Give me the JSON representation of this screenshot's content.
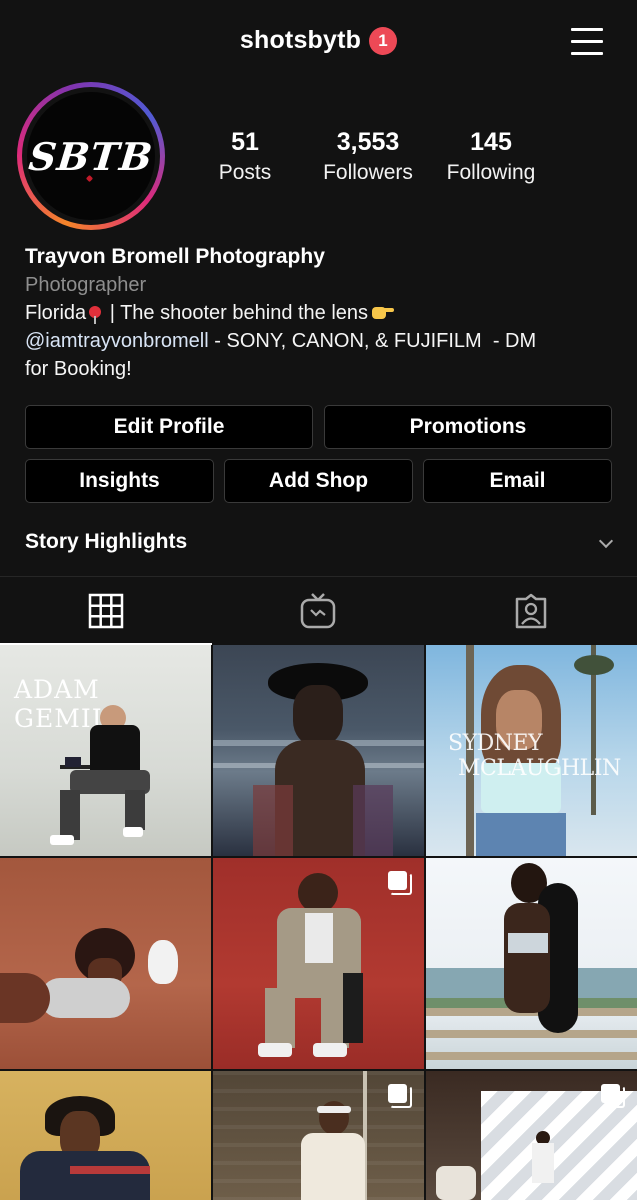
{
  "header": {
    "username": "shotsbytb",
    "notification_count": "1",
    "menu_icon": "hamburger-menu-icon"
  },
  "profile": {
    "avatar_text": "SBTB",
    "stats": [
      {
        "value": "51",
        "label": "Posts"
      },
      {
        "value": "3,553",
        "label": "Followers"
      },
      {
        "value": "145",
        "label": "Following"
      }
    ],
    "name": "Trayvon Bromell Photography",
    "category": "Photographer",
    "bio_line1_a": "Florida",
    "bio_line1_b": "| The shooter behind the lens",
    "bio_mention": "@iamtrayvonbromell",
    "bio_line2_rest": " - SONY, CANON, & FUJIFILM  - DM",
    "bio_line3": "for Booking!"
  },
  "buttons": {
    "edit_profile": "Edit Profile",
    "promotions": "Promotions",
    "insights": "Insights",
    "add_shop": "Add Shop",
    "email": "Email"
  },
  "highlights": {
    "title": "Story Highlights"
  },
  "tabs": [
    {
      "icon": "grid-icon",
      "active": true
    },
    {
      "icon": "igtv-icon",
      "active": false
    },
    {
      "icon": "tagged-user-icon",
      "active": false
    }
  ],
  "posts": [
    {
      "overlay_text": "ADAM  GEMILI",
      "multi": false
    },
    {
      "overlay_text": "",
      "multi": false
    },
    {
      "overlay_text_1": "SYDNEY",
      "overlay_text_2": "MCLAUGHLIN",
      "multi": false
    },
    {
      "overlay_text": "",
      "multi": false
    },
    {
      "overlay_text": "",
      "multi": true
    },
    {
      "overlay_text": "",
      "multi": false
    },
    {
      "overlay_text": "",
      "multi": false
    },
    {
      "overlay_text": "",
      "multi": true
    },
    {
      "overlay_text": "",
      "multi": true
    }
  ],
  "colors": {
    "background": "#121212",
    "badge": "#ed4956",
    "ring_start": "#f58529",
    "ring_end": "#8134af"
  }
}
